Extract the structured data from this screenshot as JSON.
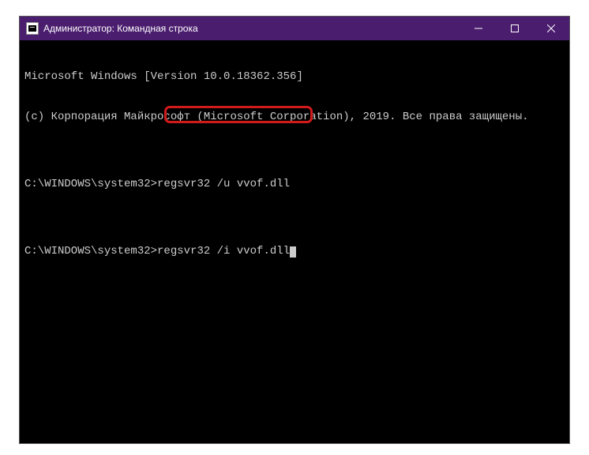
{
  "window": {
    "title": "Администратор: Командная строка"
  },
  "terminal": {
    "line1": "Microsoft Windows [Version 10.0.18362.356]",
    "line2": "(c) Корпорация Майкрософт (Microsoft Corporation), 2019. Все права защищены.",
    "blank1": "",
    "prompt1_path": "C:\\WINDOWS\\system32>",
    "prompt1_cmd": "regsvr32 /u vvof.dll",
    "blank2": "",
    "prompt2_path": "C:\\WINDOWS\\system32>",
    "prompt2_cmd": "regsvr32 /i vvof.dll"
  },
  "highlight": {
    "target": "regsvr32 /i vvof.dll"
  }
}
